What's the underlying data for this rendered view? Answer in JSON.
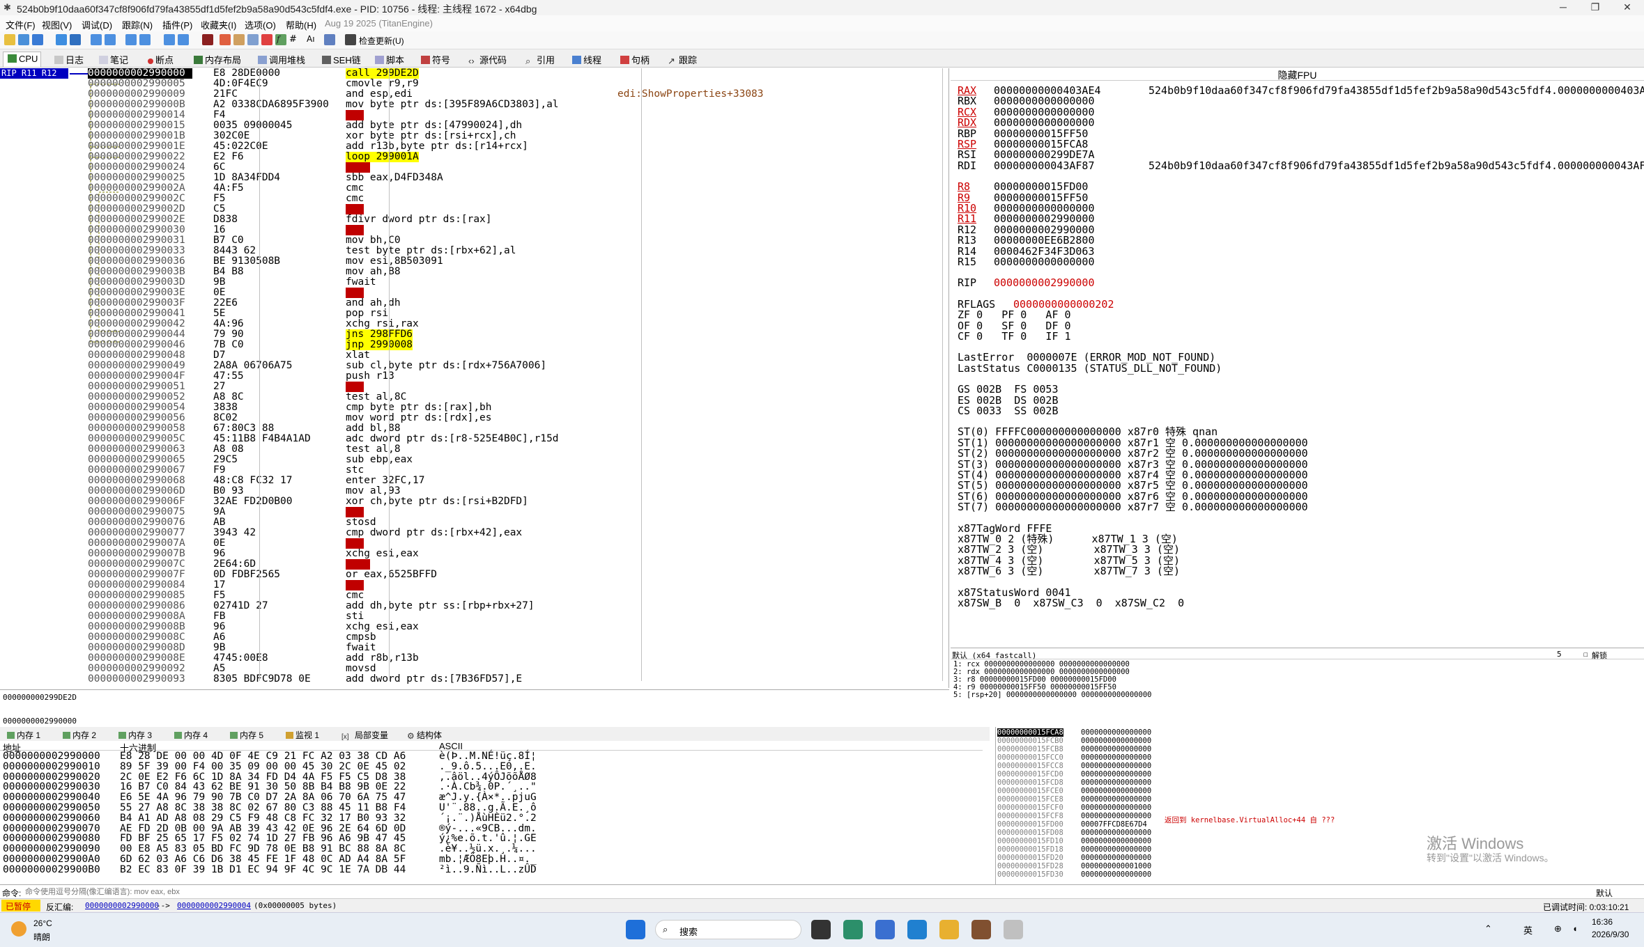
{
  "title": "524b0b9f10daa60f347cf8f906fd79fa43855df1d5fef2b9a58a90d543c5fdf4.exe - PID: 10756 - 线程: 主线程 1672 - x64dbg",
  "menu": [
    "文件(F)",
    "视图(V)",
    "调试(D)",
    "跟踪(N)",
    "插件(P)",
    "收藏夹(I)",
    "选项(O)",
    "帮助(H)",
    "Aug 19 2025 (TitanEngine)"
  ],
  "toolbar_check_update": "检查更新(U)",
  "tabs": [
    "CPU",
    "日志",
    "笔记",
    "断点",
    "内存布局",
    "调用堆栈",
    "SEH链",
    "脚本",
    "符号",
    "源代码",
    "引用",
    "线程",
    "句柄",
    "跟踪"
  ],
  "rip_label": "RIP R11 R12",
  "disasm": [
    {
      "a": "0000000002990000",
      "b": "E8 28DE0000",
      "i": "call 299DE2D",
      "c": ""
    },
    {
      "a": "0000000002990005",
      "b": "4D:0F4EC9",
      "i": "cmovle r9,r9",
      "c": ""
    },
    {
      "a": "0000000002990009",
      "b": "21FC",
      "i": "and esp,edi",
      "c": "edi:ShowProperties+33083"
    },
    {
      "a": "000000000299000B",
      "b": "A2 0338CDA6895F3900",
      "i": "mov byte ptr ds:[395F89A6CD3803],al",
      "c": ""
    },
    {
      "a": "0000000002990014",
      "b": "F4",
      "i": "hlt",
      "c": ""
    },
    {
      "a": "0000000002990015",
      "b": "0035 09000045",
      "i": "add byte ptr ds:[47990024],dh",
      "c": ""
    },
    {
      "a": "000000000299001B",
      "b": "302C0E",
      "i": "xor byte ptr ds:[rsi+rcx],ch",
      "c": ""
    },
    {
      "a": "000000000299001E",
      "b": "45:022C0E",
      "i": "add r13b,byte ptr ds:[r14+rcx]",
      "c": ""
    },
    {
      "a": "0000000002990022",
      "b": "E2 F6",
      "i": "loop 299001A",
      "c": ""
    },
    {
      "a": "0000000002990024",
      "b": "6C",
      "i": "insb",
      "c": ""
    },
    {
      "a": "0000000002990025",
      "b": "1D 8A34FDD4",
      "i": "sbb eax,D4FD348A",
      "c": ""
    },
    {
      "a": "000000000299002A",
      "b": "4A:F5",
      "i": "cmc",
      "c": ""
    },
    {
      "a": "000000000299002C",
      "b": "F5",
      "i": "cmc",
      "c": ""
    },
    {
      "a": "000000000299002D",
      "b": "C5",
      "i": "???",
      "c": ""
    },
    {
      "a": "000000000299002E",
      "b": "D838",
      "i": "fdivr dword ptr ds:[rax]",
      "c": ""
    },
    {
      "a": "0000000002990030",
      "b": "16",
      "i": "???",
      "c": ""
    },
    {
      "a": "0000000002990031",
      "b": "B7 C0",
      "i": "mov bh,C0",
      "c": ""
    },
    {
      "a": "0000000002990033",
      "b": "8443 62",
      "i": "test byte ptr ds:[rbx+62],al",
      "c": ""
    },
    {
      "a": "0000000002990036",
      "b": "BE 9130508B",
      "i": "mov esi,8B503091",
      "c": ""
    },
    {
      "a": "000000000299003B",
      "b": "B4 B8",
      "i": "mov ah,B8",
      "c": ""
    },
    {
      "a": "000000000299003D",
      "b": "9B",
      "i": "fwait",
      "c": ""
    },
    {
      "a": "000000000299003E",
      "b": "0E",
      "i": "???",
      "c": ""
    },
    {
      "a": "000000000299003F",
      "b": "22E6",
      "i": "and ah,dh",
      "c": ""
    },
    {
      "a": "0000000002990041",
      "b": "5E",
      "i": "pop rsi",
      "c": ""
    },
    {
      "a": "0000000002990042",
      "b": "4A:96",
      "i": "xchg rsi,rax",
      "c": ""
    },
    {
      "a": "0000000002990044",
      "b": "79 90",
      "i": "jns 298FFD6",
      "c": ""
    },
    {
      "a": "0000000002990046",
      "b": "7B C0",
      "i": "jnp 2990008",
      "c": ""
    },
    {
      "a": "0000000002990048",
      "b": "D7",
      "i": "xlat",
      "c": ""
    },
    {
      "a": "0000000002990049",
      "b": "2A8A 06706A75",
      "i": "sub cl,byte ptr ds:[rdx+756A7006]",
      "c": ""
    },
    {
      "a": "000000000299004F",
      "b": "47:55",
      "i": "push r13",
      "c": ""
    },
    {
      "a": "0000000002990051",
      "b": "27",
      "i": "???",
      "c": ""
    },
    {
      "a": "0000000002990052",
      "b": "A8 8C",
      "i": "test al,8C",
      "c": ""
    },
    {
      "a": "0000000002990054",
      "b": "3838",
      "i": "cmp byte ptr ds:[rax],bh",
      "c": ""
    },
    {
      "a": "0000000002990056",
      "b": "8C02",
      "i": "mov word ptr ds:[rdx],es",
      "c": ""
    },
    {
      "a": "0000000002990058",
      "b": "67:80C3 88",
      "i": "add bl,88",
      "c": ""
    },
    {
      "a": "000000000299005C",
      "b": "45:11B8 F4B4A1AD",
      "i": "adc dword ptr ds:[r8-525E4B0C],r15d",
      "c": ""
    },
    {
      "a": "0000000002990063",
      "b": "A8 08",
      "i": "test al,8",
      "c": ""
    },
    {
      "a": "0000000002990065",
      "b": "29C5",
      "i": "sub ebp,eax",
      "c": ""
    },
    {
      "a": "0000000002990067",
      "b": "F9",
      "i": "stc",
      "c": ""
    },
    {
      "a": "0000000002990068",
      "b": "48:C8 FC32 17",
      "i": "enter 32FC,17",
      "c": ""
    },
    {
      "a": "000000000299006D",
      "b": "B0 93",
      "i": "mov al,93",
      "c": ""
    },
    {
      "a": "000000000299006F",
      "b": "32AE FD2D0B00",
      "i": "xor ch,byte ptr ds:[rsi+B2DFD]",
      "c": ""
    },
    {
      "a": "0000000002990075",
      "b": "9A",
      "i": "???",
      "c": ""
    },
    {
      "a": "0000000002990076",
      "b": "AB",
      "i": "stosd",
      "c": ""
    },
    {
      "a": "0000000002990077",
      "b": "3943 42",
      "i": "cmp dword ptr ds:[rbx+42],eax",
      "c": ""
    },
    {
      "a": "000000000299007A",
      "b": "0E",
      "i": "???",
      "c": ""
    },
    {
      "a": "000000000299007B",
      "b": "96",
      "i": "xchg esi,eax",
      "c": ""
    },
    {
      "a": "000000000299007C",
      "b": "2E64:6D",
      "i": "insd",
      "c": ""
    },
    {
      "a": "000000000299007F",
      "b": "0D FDBF2565",
      "i": "or eax,6525BFFD",
      "c": ""
    },
    {
      "a": "0000000002990084",
      "b": "17",
      "i": "???",
      "c": ""
    },
    {
      "a": "0000000002990085",
      "b": "F5",
      "i": "cmc",
      "c": ""
    },
    {
      "a": "0000000002990086",
      "b": "02741D 27",
      "i": "add dh,byte ptr ss:[rbp+rbx+27]",
      "c": ""
    },
    {
      "a": "000000000299008A",
      "b": "FB",
      "i": "sti",
      "c": ""
    },
    {
      "a": "000000000299008B",
      "b": "96",
      "i": "xchg esi,eax",
      "c": ""
    },
    {
      "a": "000000000299008C",
      "b": "A6",
      "i": "cmpsb",
      "c": ""
    },
    {
      "a": "000000000299008D",
      "b": "9B",
      "i": "fwait",
      "c": ""
    },
    {
      "a": "000000000299008E",
      "b": "4745:00E8",
      "i": "add r8b,r13b",
      "c": ""
    },
    {
      "a": "0000000002990092",
      "b": "A5",
      "i": "movsd",
      "c": ""
    },
    {
      "a": "0000000002990093",
      "b": "8305 BDFC9D78 0E",
      "i": "add dword ptr ds:[7B36FD57],E",
      "c": ""
    }
  ],
  "info_line1": "000000000299DE2D",
  "info_line2": "0000000002990000",
  "reg_header": "隐藏FPU",
  "regs": [
    {
      "n": "RAX",
      "v": "00000000000403AE4",
      "x": "524b0b9f10daa60f347cf8f906fd79fa43855df1d5fef2b9a58a90d543c5fdf4.0000000000403AE4"
    },
    {
      "n": "RBX",
      "v": "0000000000000000",
      "x": ""
    },
    {
      "n": "RCX",
      "v": "0000000000000000",
      "x": ""
    },
    {
      "n": "RDX",
      "v": "0000000000000000",
      "x": ""
    },
    {
      "n": "RBP",
      "v": "00000000015FF50",
      "x": ""
    },
    {
      "n": "RSP",
      "v": "00000000015FCA8",
      "x": ""
    },
    {
      "n": "RSI",
      "v": "000000000299DE7A",
      "x": ""
    },
    {
      "n": "RDI",
      "v": "000000000043AF87",
      "x": "524b0b9f10daa60f347cf8f906fd79fa43855df1d5fef2b9a58a90d543c5fdf4.000000000043AF87"
    }
  ],
  "regs2": [
    {
      "n": "R8",
      "v": "00000000015FD00"
    },
    {
      "n": "R9",
      "v": "00000000015FF50"
    },
    {
      "n": "R10",
      "v": "0000000000000000"
    },
    {
      "n": "R11",
      "v": "0000000002990000"
    },
    {
      "n": "R12",
      "v": "0000000002990000"
    },
    {
      "n": "R13",
      "v": "00000000EE6B2800"
    },
    {
      "n": "R14",
      "v": "0000462F34F3D063"
    },
    {
      "n": "R15",
      "v": "0000000000000000"
    }
  ],
  "rip": {
    "n": "RIP",
    "v": "0000000002990000"
  },
  "rflags": {
    "n": "RFLAGS",
    "v": "0000000000000202"
  },
  "flags": [
    "ZF 0   PF 0   AF 0",
    "OF 0   SF 0   DF 0",
    "CF 0   TF 0   IF 1"
  ],
  "lasterror": "LastError  0000007E (ERROR_MOD_NOT_FOUND)",
  "laststatus": "LastStatus C0000135 (STATUS_DLL_NOT_FOUND)",
  "segs": [
    "GS 002B  FS 0053",
    "ES 002B  DS 002B",
    "CS 0033  SS 002B"
  ],
  "fpu": [
    "ST(0) FFFFC000000000000000 x87r0 特殊 qnan",
    "ST(1) 00000000000000000000 x87r1 空 0.000000000000000000",
    "ST(2) 00000000000000000000 x87r2 空 0.000000000000000000",
    "ST(3) 00000000000000000000 x87r3 空 0.000000000000000000",
    "ST(4) 00000000000000000000 x87r4 空 0.000000000000000000",
    "ST(5) 00000000000000000000 x87r5 空 0.000000000000000000",
    "ST(6) 00000000000000000000 x87r6 空 0.000000000000000000",
    "ST(7) 00000000000000000000 x87r7 空 0.000000000000000000"
  ],
  "tagword": [
    "x87TagWord FFFE",
    "x87TW_0 2 (特殊)      x87TW_1 3 (空)",
    "x87TW_2 3 (空)        x87TW_3 3 (空)",
    "x87TW_4 3 (空)        x87TW_5 3 (空)",
    "x87TW_6 3 (空)        x87TW_7 3 (空)"
  ],
  "statusword": [
    "x87StatusWord 0041",
    "x87SW_B  0  x87SW_C3  0  x87SW_C2  0"
  ],
  "callconv": {
    "label": "默认 (x64 fastcall)",
    "count": "5",
    "unlock": "解锁",
    "lines": [
      "1: rcx 0000000000000000 0000000000000000",
      "2: rdx 0000000000000000 0000000000000000",
      "3: r8 00000000015FD00 00000000015FD00",
      "4: r9 00000000015FF50 00000000015FF50",
      "5: [rsp+20] 0000000000000000 0000000000000000"
    ]
  },
  "memtabs": [
    "内存 1",
    "内存 2",
    "内存 3",
    "内存 4",
    "内存 5",
    "监视 1",
    "局部变量",
    "结构体"
  ],
  "dump_headers": {
    "addr": "地址",
    "hex": "十六进制",
    "ascii": "ASCII"
  },
  "dump": [
    {
      "a": "0000000002990000",
      "h": "E8 28 DE 00 00 4D 0F 4E C9 21 FC A2 03 38 CD A6",
      "s": "è(Þ..M.NÉ!üç.8Í¦"
    },
    {
      "a": "0000000002990010",
      "h": "89 5F 39 00 F4 00 35 09 00 00 45 30 2C 0E 45 02",
      "s": "._9.ô.5...E0,.E."
    },
    {
      "a": "0000000002990020",
      "h": "2C 0E E2 F6 6C 1D 8A 34 FD D4 4A F5 F5 C5 D8 38",
      "s": ",.âöl..4ýÔJõõÅØ8"
    },
    {
      "a": "0000000002990030",
      "h": "16 B7 C0 84 43 62 BE 91 30 50 8B B4 B8 9B 0E 22",
      "s": ".·À.Cb¾.0P.´¸..\""
    },
    {
      "a": "0000000002990040",
      "h": "E6 5E 4A 96 79 90 7B C0 D7 2A 8A 06 70 6A 75 47",
      "s": "æ^J.y.{À×*..pjuG"
    },
    {
      "a": "0000000002990050",
      "h": "55 27 A8 8C 38 38 8C 02 67 80 C3 88 45 11 B8 F4",
      "s": "U'¨.88..g.Ã.E.¸ô"
    },
    {
      "a": "0000000002990060",
      "h": "B4 A1 AD A8 08 29 C5 F9 48 C8 FC 32 17 B0 93 32",
      "s": "´¡.¨.)ÅùHÈü2.°.2"
    },
    {
      "a": "0000000002990070",
      "h": "AE FD 2D 0B 00 9A AB 39 43 42 0E 96 2E 64 6D 0D",
      "s": "®ý-...«9CB...dm."
    },
    {
      "a": "0000000002990080",
      "h": "FD BF 25 65 17 F5 02 74 1D 27 FB 96 A6 9B 47 45",
      "s": "ý¿%e.õ.t.'û.¦.GE"
    },
    {
      "a": "0000000002990090",
      "h": "00 E8 A5 83 05 BD FC 9D 78 0E B8 91 BC 88 8A 8C",
      "s": ".è¥..½ü.x.¸.¼..."
    },
    {
      "a": "00000000029900A0",
      "h": "6D 62 03 A6 C6 D6 38 45 FE 1F 48 0C AD A4 8A 5F",
      "s": "mb.¦ÆÖ8Eþ.H..¤._"
    },
    {
      "a": "00000000029900B0",
      "h": "B2 EC 83 0F 39 1B D1 EC 94 9F 4C 9C 1E 7A DB 44",
      "s": "²ì..9.Ñì..L..zÛD"
    }
  ],
  "stack": [
    {
      "a": "00000000015FCA8",
      "v": "0000000000000000"
    },
    {
      "a": "00000000015FCB0",
      "v": "0000000000000000"
    },
    {
      "a": "00000000015FCB8",
      "v": "0000000000000000"
    },
    {
      "a": "00000000015FCC0",
      "v": "0000000000000000"
    },
    {
      "a": "00000000015FCC8",
      "v": "0000000000000000"
    },
    {
      "a": "00000000015FCD0",
      "v": "0000000000000000"
    },
    {
      "a": "00000000015FCD8",
      "v": "0000000000000000"
    },
    {
      "a": "00000000015FCE0",
      "v": "0000000000000000"
    },
    {
      "a": "00000000015FCE8",
      "v": "0000000000000000"
    },
    {
      "a": "00000000015FCF0",
      "v": "0000000000000000"
    },
    {
      "a": "00000000015FCF8",
      "v": "0000000000000000"
    },
    {
      "a": "00000000015FD00",
      "v": "00007FFCD8E67D4"
    },
    {
      "a": "00000000015FD08",
      "v": "0000000000000000"
    },
    {
      "a": "00000000015FD10",
      "v": "0000000000000000"
    },
    {
      "a": "00000000015FD18",
      "v": "0000000000000000"
    },
    {
      "a": "00000000015FD20",
      "v": "0000000000000000"
    },
    {
      "a": "00000000015FD28",
      "v": "0000000000001000"
    },
    {
      "a": "00000000015FD30",
      "v": "0000000000000000"
    }
  ],
  "stack_comment": "返回到 kernelbase.VirtualAlloc+44 自 ???",
  "watermark": [
    "激活 Windows",
    "转到\"设置\"以激活 Windows。"
  ],
  "cmd_label": "命令:",
  "cmd_placeholder": "命令使用逗号分隔(像汇编语言): mov eax, ebx",
  "cmd_default": "默认",
  "status": {
    "state": "已暂停",
    "text1": "反汇编:",
    "link1": "0000000002990000",
    "dash": "-->",
    "link2": "0000000002990004",
    "text2": "(0x00000005  bytes)",
    "time": "已调试时间:  0:03:10:21"
  },
  "taskbar": {
    "temp": "26°C",
    "weather": "晴朗",
    "search": "搜索",
    "lang": "英",
    "time": "16:36",
    "date": "2026/9/30"
  }
}
